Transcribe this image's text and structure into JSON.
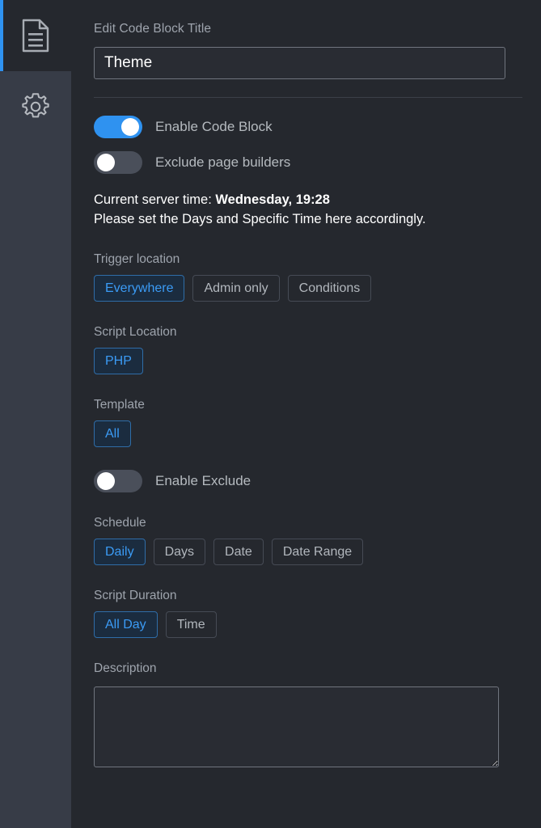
{
  "sidebar": {
    "tabs": [
      {
        "id": "document",
        "icon": "document-icon",
        "active": true
      },
      {
        "id": "settings",
        "icon": "gear-icon",
        "active": false
      }
    ],
    "accent_color": "#2f92f0"
  },
  "colors": {
    "accent": "#2f92f0",
    "selected_text": "#3b9bf5",
    "selected_bg": "#1b2c3f",
    "selected_border": "#2f6da8",
    "panel_bg": "#25282e",
    "rail_bg": "#373c47",
    "label": "#9ea4ad",
    "body_text": "#ffffff"
  },
  "title_field": {
    "label": "Edit Code Block Title",
    "value": "Theme",
    "placeholder": ""
  },
  "toggles": {
    "enable_code_block": {
      "label": "Enable Code Block",
      "state": "on"
    },
    "exclude_page_builders": {
      "label": "Exclude page builders",
      "state": "off"
    },
    "enable_exclude": {
      "label": "Enable Exclude",
      "state": "off"
    }
  },
  "server_time": {
    "prefix": "Current server time: ",
    "value": "Wednesday, 19:28",
    "hint": "Please set the Days and Specific Time here accordingly."
  },
  "trigger_location": {
    "label": "Trigger location",
    "options": [
      "Everywhere",
      "Admin only",
      "Conditions"
    ],
    "selected": "Everywhere"
  },
  "script_location": {
    "label": "Script Location",
    "options": [
      "PHP"
    ],
    "selected": "PHP"
  },
  "template": {
    "label": "Template",
    "options": [
      "All"
    ],
    "selected": "All"
  },
  "schedule": {
    "label": "Schedule",
    "options": [
      "Daily",
      "Days",
      "Date",
      "Date Range"
    ],
    "selected": "Daily"
  },
  "script_duration": {
    "label": "Script Duration",
    "options": [
      "All Day",
      "Time"
    ],
    "selected": "All Day"
  },
  "description": {
    "label": "Description",
    "value": "",
    "placeholder": ""
  }
}
